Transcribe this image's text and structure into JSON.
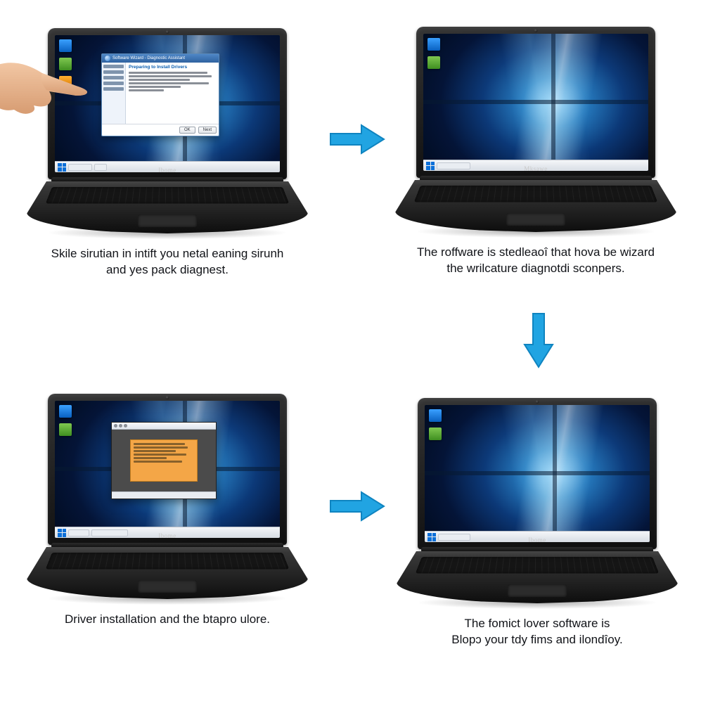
{
  "brand": "Ibome",
  "brand_alt": "Mksawe",
  "captions": {
    "step1_line1": "Skile sirutian in intift you netal eaning sirunh",
    "step1_line2": "and yes pack diagnest.",
    "step2_line1": "The roffware is stedleaoî that hova be wizard",
    "step2_line2": "the wrilcature diagnotdi sconpers.",
    "step3": "Driver installation and the btapro ulore.",
    "step4_line1": "The fomict lover software is",
    "step4_line2": "Blopɔ your tdy fims and ilondîoy."
  },
  "dialog1": {
    "title": "Software Wizard - Diagnostic Assistant",
    "heading": "Preparing to Install Drivers",
    "ok": "OK",
    "cancel": "Next"
  },
  "colors": {
    "arrow": "#1fa2e0",
    "desktop_bg_center": "#2a8ad8",
    "dialog_accent": "#f4a647"
  }
}
